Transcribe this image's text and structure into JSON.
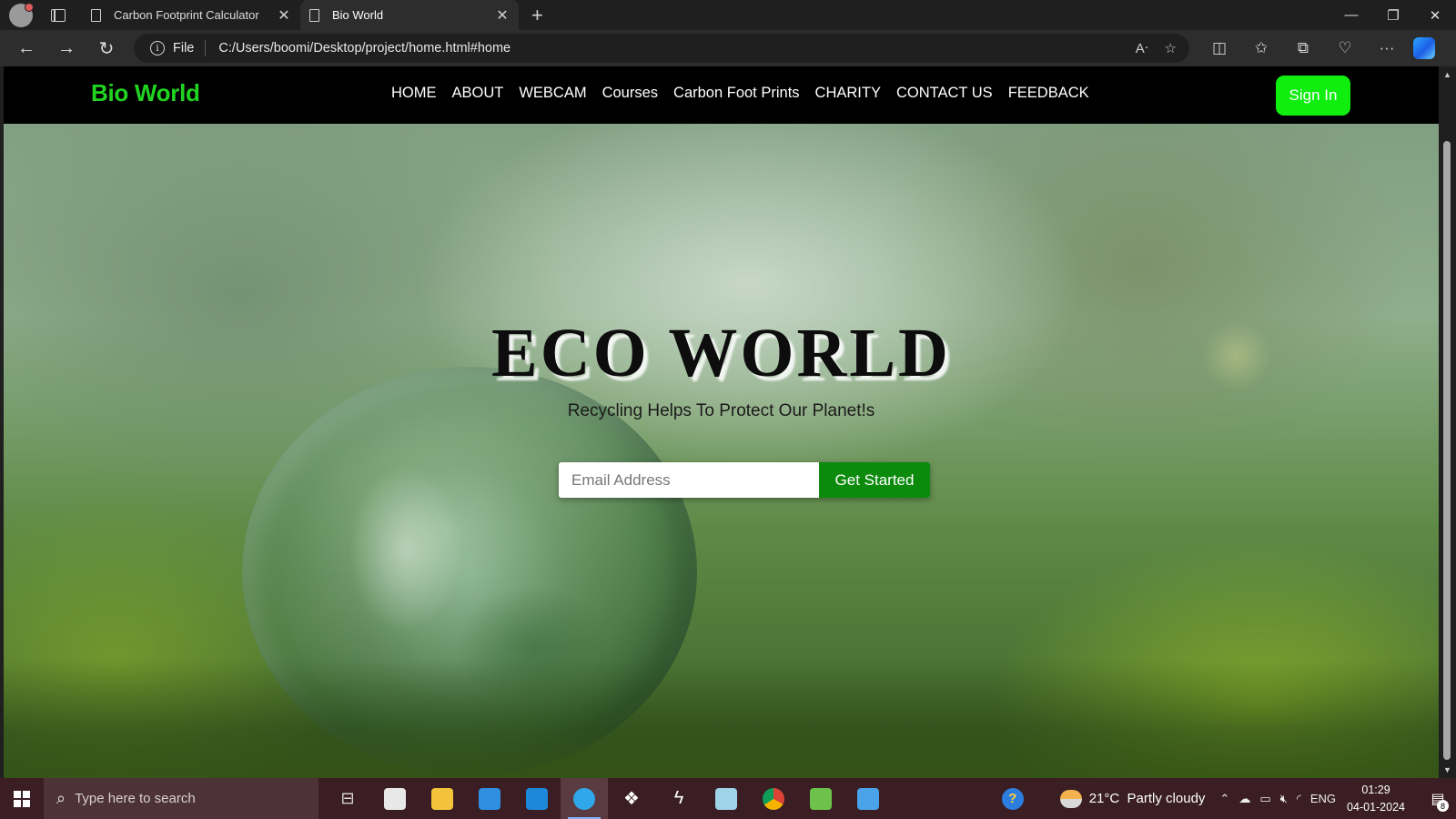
{
  "browser": {
    "tabs": [
      {
        "title": "Carbon Footprint Calculator",
        "active": false
      },
      {
        "title": "Bio World",
        "active": true
      }
    ],
    "address": {
      "scheme_label": "File",
      "url": "C:/Users/boomi/Desktop/project/home.html#home"
    }
  },
  "site": {
    "brand": "Bio World",
    "nav_links": [
      "HOME",
      "ABOUT",
      "WEBCAM",
      "Courses",
      "Carbon Foot Prints",
      "CHARITY",
      "CONTACT US",
      "FEEDBACK"
    ],
    "signin_label": "Sign In",
    "hero": {
      "title": "ECO WORLD",
      "subtitle": "Recycling Helps To Protect Our Planet!s",
      "email_placeholder": "Email Address",
      "cta_label": "Get Started"
    },
    "colors": {
      "brand_green": "#21d421",
      "signin_green": "#10ee10",
      "cta_green": "#0b8a0b",
      "nav_bg": "#000000"
    }
  },
  "taskbar": {
    "search_placeholder": "Type here to search",
    "apps": [
      "task-view",
      "store",
      "file-explorer",
      "mail",
      "vscode",
      "edge",
      "dropbox",
      "app-bolt",
      "app-notes",
      "chrome",
      "nodejs",
      "app-remote"
    ],
    "weather": {
      "temp": "21°C",
      "condition": "Partly cloudy"
    },
    "language": "ENG",
    "time": "01:29",
    "date": "04-01-2024",
    "notification_count": "8"
  }
}
